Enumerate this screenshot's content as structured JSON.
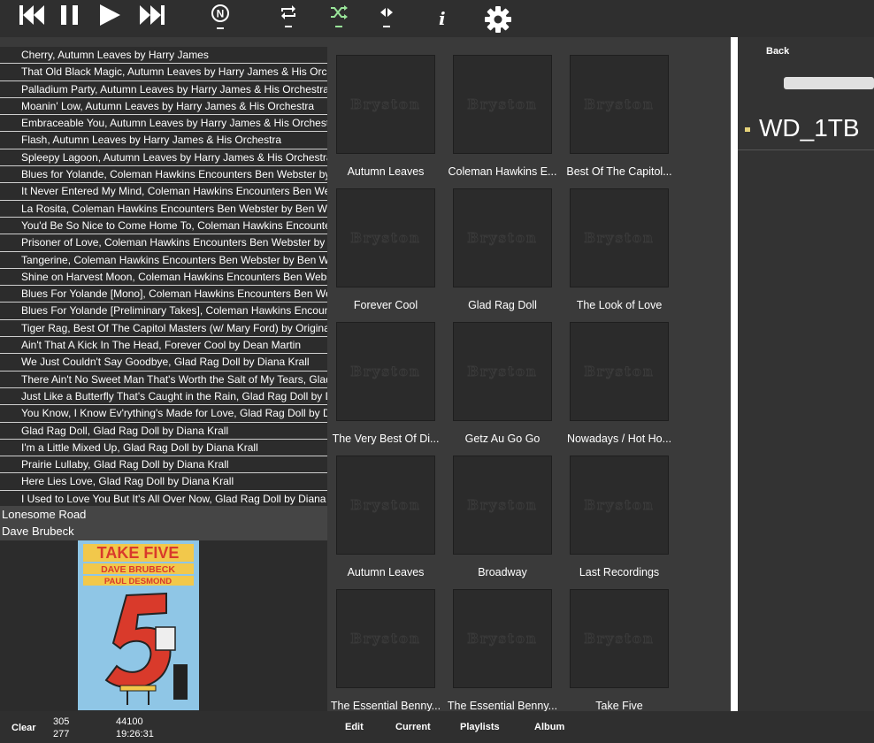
{
  "toolbar": {
    "icons": [
      "previous-track-icon",
      "pause-icon",
      "play-icon",
      "next-track-icon",
      "normalize-icon",
      "repeat-icon",
      "shuffle-icon",
      "balance-icon",
      "info-icon",
      "gear-icon"
    ],
    "normalize_letter": "N",
    "info_letter": "i",
    "active_color": "#9ae59a"
  },
  "playlist": {
    "items": [
      "Cherry, Autumn Leaves by Harry James",
      "That Old Black Magic, Autumn Leaves by Harry James & His Orchestra",
      "Palladium Party, Autumn Leaves by Harry James & His Orchestra",
      "Moanin' Low, Autumn Leaves by Harry James & His Orchestra",
      "Embraceable You, Autumn Leaves by Harry James & His Orchestra",
      "Flash, Autumn Leaves by Harry James & His Orchestra",
      "Spleepy Lagoon, Autumn Leaves by Harry James & His Orchestra",
      "Blues for Yolande, Coleman Hawkins Encounters Ben Webster by Ben Webster",
      "It Never Entered My Mind, Coleman Hawkins Encounters Ben Webster by Ben Webster",
      "La Rosita, Coleman Hawkins Encounters Ben Webster by Ben Webster",
      "You'd Be So Nice to Come Home To, Coleman Hawkins Encounters Ben Webster",
      "Prisoner of Love, Coleman Hawkins Encounters Ben Webster by Ben Webster",
      "Tangerine, Coleman Hawkins Encounters Ben Webster by Ben Webster",
      "Shine on Harvest Moon, Coleman Hawkins Encounters Ben Webster by Ben Webster",
      "Blues For Yolande [Mono], Coleman Hawkins Encounters Ben Webster",
      "Blues For Yolande [Preliminary Takes], Coleman Hawkins Encounters Ben Webster",
      "Tiger Rag, Best Of The Capitol Masters (w/ Mary Ford) by Original",
      "Ain't That A Kick In The Head, Forever Cool by Dean Martin",
      "We Just Couldn't Say Goodbye, Glad Rag Doll by Diana Krall",
      "There Ain't No Sweet Man That's Worth the Salt of My Tears, Glad Rag Doll",
      "Just Like a Butterfly That's Caught in the Rain, Glad Rag Doll by Diana Krall",
      "You Know, I Know Ev'rything's Made for Love, Glad Rag Doll by Diana Krall",
      "Glad Rag Doll, Glad Rag Doll by Diana Krall",
      "I'm a Little Mixed Up, Glad Rag Doll by Diana Krall",
      "Prairie Lullaby, Glad Rag Doll by Diana Krall",
      "Here Lies Love, Glad Rag Doll by Diana Krall",
      "I Used to Love You But It's All Over Now, Glad Rag Doll by Diana Krall"
    ]
  },
  "now_playing": {
    "title": "Lonesome Road",
    "artist": "Dave Brubeck",
    "album_art": {
      "title": "TAKE FIVE",
      "line1": "DAVE BRUBECK",
      "line2": "PAUL DESMOND",
      "bg_color": "#8fc6e6"
    }
  },
  "grid": {
    "placeholder_text": "Bryston",
    "albums": [
      "Autumn Leaves",
      "Coleman Hawkins E...",
      "Best Of The Capitol...",
      "Forever Cool",
      "Glad Rag Doll",
      "The Look of Love",
      "The Very Best Of Di...",
      "Getz Au Go Go",
      "Nowadays / Hot Ho...",
      "Autumn Leaves",
      "Broadway",
      "Last Recordings",
      "The Essential Benny...",
      "The Essential Benny...",
      "Take Five"
    ]
  },
  "browser": {
    "back_label": "Back",
    "drive_label": "WD_1TB"
  },
  "bottom": {
    "clear_label": "Clear",
    "count_top": "305",
    "count_bottom": "277",
    "rate": "44100",
    "time": "19:26:31",
    "tabs": [
      "Edit",
      "Current",
      "Playlists",
      "Album"
    ]
  }
}
